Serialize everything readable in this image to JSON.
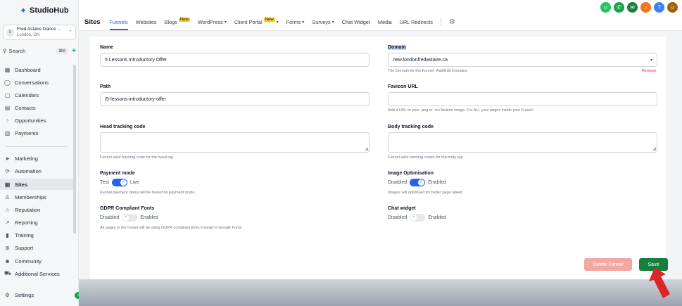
{
  "brand": {
    "name": "StudioHub"
  },
  "account": {
    "name": "Fred Astaire Dance ...",
    "location": "London, ON",
    "avatar_letter": "8"
  },
  "search": {
    "label": "Search",
    "shortcut": "⌘K"
  },
  "sidebar": {
    "items": [
      {
        "label": "Dashboard",
        "icon": "dashboard-icon"
      },
      {
        "label": "Conversations",
        "icon": "chat-icon"
      },
      {
        "label": "Calendars",
        "icon": "calendar-icon"
      },
      {
        "label": "Contacts",
        "icon": "contacts-icon"
      },
      {
        "label": "Opportunities",
        "icon": "opportunities-icon"
      },
      {
        "label": "Payments",
        "icon": "payments-icon"
      },
      {
        "label": "Marketing",
        "icon": "send-icon"
      },
      {
        "label": "Automation",
        "icon": "automation-icon"
      },
      {
        "label": "Sites",
        "icon": "sites-icon"
      },
      {
        "label": "Memberships",
        "icon": "memberships-icon"
      },
      {
        "label": "Reputation",
        "icon": "star-icon"
      },
      {
        "label": "Reporting",
        "icon": "trend-icon"
      },
      {
        "label": "Training",
        "icon": "book-icon"
      },
      {
        "label": "Support",
        "icon": "support-icon"
      },
      {
        "label": "Community",
        "icon": "community-icon"
      },
      {
        "label": "Additional Services",
        "icon": "cart-icon"
      },
      {
        "label": "Settings",
        "icon": "gear-icon"
      }
    ],
    "active": "Sites"
  },
  "header": {
    "section": "Sites",
    "tabs": [
      {
        "label": "Funnels",
        "active": true
      },
      {
        "label": "Websites"
      },
      {
        "label": "Blogs",
        "badge": "New"
      },
      {
        "label": "WordPress"
      },
      {
        "label": "Client Portal",
        "badge": "New"
      },
      {
        "label": "Forms"
      },
      {
        "label": "Surveys"
      },
      {
        "label": "Chat Widget"
      },
      {
        "label": "Media"
      },
      {
        "label": "URL Redirects"
      }
    ]
  },
  "form": {
    "name": {
      "label": "Name",
      "value": "5 Lessons Introductory Offer"
    },
    "domain": {
      "label": "Domain",
      "value": "new.londonfredastaire.ca",
      "help": "The Domain for the Funnel -Add/Edit Domains",
      "remove": "Remove"
    },
    "path": {
      "label": "Path",
      "value": "/5-lessons-introductory-offer"
    },
    "favicon": {
      "label": "Favicon URL",
      "value": "",
      "help": "Add a URL to your .png or .ico favicon image. For ALL your pages inside your Funnel"
    },
    "head_tracking": {
      "label": "Head tracking code",
      "help": "Funnel wide tracking code for the head tag"
    },
    "body_tracking": {
      "label": "Body tracking code",
      "help": "Funnel wide tracking codes for the body tag"
    },
    "payment_mode": {
      "label": "Payment mode",
      "left": "Test",
      "right": "Live",
      "on": true,
      "help": "Funnel payment status will be based on payment mode."
    },
    "image_opt": {
      "label": "Image Optimisation",
      "left": "Disabled",
      "right": "Enabled",
      "on": true,
      "help": "Images will optimised for better page speed"
    },
    "gdpr": {
      "label": "GDPR Compliant Fonts",
      "left": "Disabled",
      "right": "Enabled",
      "on": false,
      "help": "All pages in the funnel will be using GDPR compliant fonts instead of Google Fonts"
    },
    "chat_widget": {
      "label": "Chat widget",
      "left": "Disabled",
      "right": "Enabled",
      "on": false
    }
  },
  "actions": {
    "delete": "Delete Funnel",
    "save": "Save"
  },
  "colors": {
    "accent": "#2563eb",
    "save": "#15803d",
    "delete": "#f2a7a7",
    "arrow": "#dc2626"
  }
}
